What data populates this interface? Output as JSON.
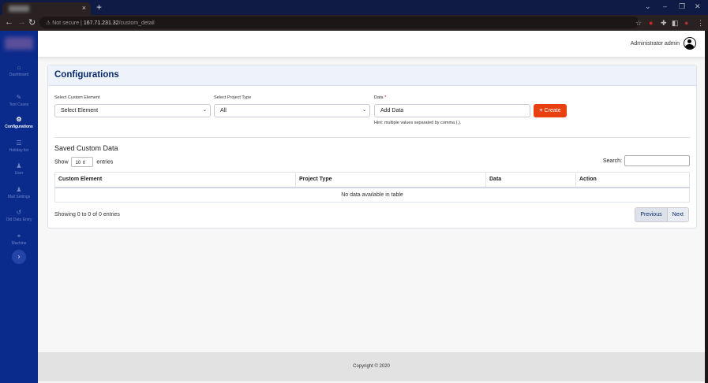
{
  "browser": {
    "url_prefix": "Not secure",
    "url_host": "167.71.231.32",
    "url_path": "/custom_detail",
    "close_tab": "×",
    "new_tab": "+"
  },
  "sidebar": {
    "items": [
      {
        "label": "Dashboard",
        "icon": "⌂"
      },
      {
        "label": "Test Cases",
        "icon": "✎"
      },
      {
        "label": "Configurations",
        "icon": "⚙"
      },
      {
        "label": "Holiday list",
        "icon": "☰"
      },
      {
        "label": "User",
        "icon": "♟"
      },
      {
        "label": "Mail Settings",
        "icon": "♟"
      },
      {
        "label": "Old Data Entry",
        "icon": "↺"
      },
      {
        "label": "Machine",
        "icon": "⚭"
      }
    ],
    "active": "Configurations",
    "expand": "›"
  },
  "header": {
    "user": "Administrator admin"
  },
  "card": {
    "title": "Configurations",
    "form": {
      "element_label": "Select Custom Element",
      "element_value": "Select Element",
      "project_label": "Select Project Type",
      "project_value": "All",
      "data_label": "Data",
      "data_required": "*",
      "data_placeholder": "Add Data",
      "create_label": "Create",
      "create_icon": "+",
      "hint": "Hint: multiple values separated by comma (,)."
    },
    "saved_title": "Saved Custom Data",
    "show": "Show",
    "length": "10",
    "entries": "entries",
    "search_label": "Search:",
    "table": {
      "columns": [
        "Custom Element",
        "Project Type",
        "Data",
        "Action"
      ],
      "empty": "No data available in table"
    },
    "info": "Showing 0 to 0 of 0 entries",
    "previous": "Previous",
    "next": "Next"
  },
  "footer": "Copyright © 2020"
}
